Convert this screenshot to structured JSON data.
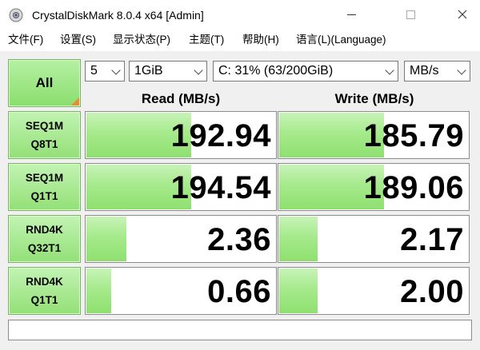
{
  "window": {
    "title": "CrystalDiskMark 8.0.4 x64 [Admin]"
  },
  "menu": [
    "文件(F)",
    "设置(S)",
    "显示状态(P)",
    "主题(T)",
    "帮助(H)",
    "语言(L)(Language)"
  ],
  "controls": {
    "all_label": "All",
    "count": "5",
    "size": "1GiB",
    "drive": "C: 31% (63/200GiB)",
    "unit": "MB/s"
  },
  "headers": {
    "read": "Read (MB/s)",
    "write": "Write (MB/s)"
  },
  "tests": [
    {
      "line1": "SEQ1M",
      "line2": "Q8T1",
      "read": "192.94",
      "write": "185.79",
      "read_fill": 0.55,
      "write_fill": 0.55
    },
    {
      "line1": "SEQ1M",
      "line2": "Q1T1",
      "read": "194.54",
      "write": "189.06",
      "read_fill": 0.55,
      "write_fill": 0.55
    },
    {
      "line1": "RND4K",
      "line2": "Q32T1",
      "read": "2.36",
      "write": "2.17",
      "read_fill": 0.21,
      "write_fill": 0.2
    },
    {
      "line1": "RND4K",
      "line2": "Q1T1",
      "read": "0.66",
      "write": "2.00",
      "read_fill": 0.13,
      "write_fill": 0.2
    }
  ],
  "status_text": "",
  "colors": {
    "button_green": "#8ade6d",
    "bar_green": "#a6ea8c",
    "corner_orange": "#ee8a2c"
  }
}
